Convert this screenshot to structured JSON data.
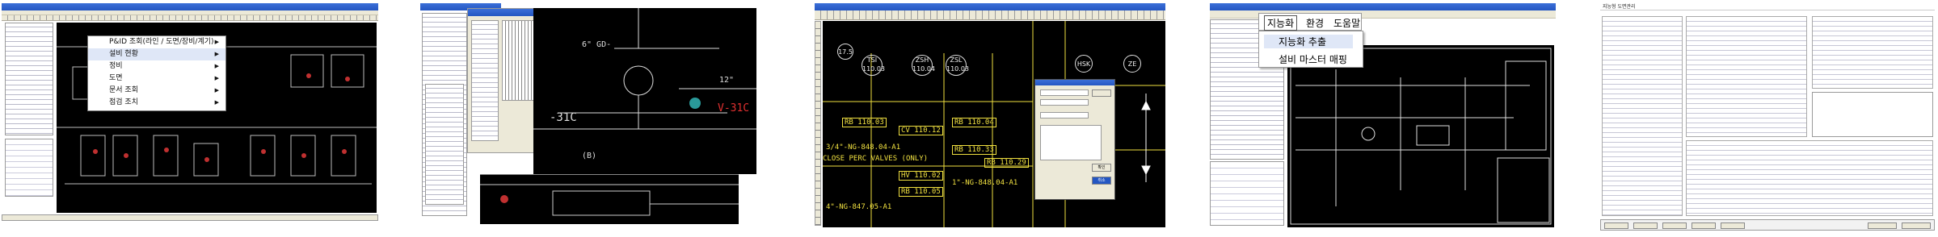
{
  "screen1": {
    "context_menu": {
      "items": [
        {
          "label": "P&ID 조회(라인 / 도면/장비/계기)",
          "arrow": "▶"
        },
        {
          "label": "설비 현황",
          "arrow": "▶"
        },
        {
          "label": "정비",
          "arrow": "▶"
        },
        {
          "label": "도면",
          "arrow": "▶"
        },
        {
          "label": "문서 조회",
          "arrow": "▶"
        },
        {
          "label": "점검 조치",
          "arrow": "▶"
        }
      ]
    }
  },
  "screen2": {
    "labels": [
      "6\" GD-",
      "-31C",
      "12\"",
      "(B)",
      "V-31C"
    ]
  },
  "screen3": {
    "bubbles": [
      "17.5",
      "TSI 110.03",
      "ZSH 110.04",
      "ZSL 110.03",
      "HSK",
      "ZE"
    ],
    "boxed_labels": [
      "RB 110.03",
      "CV 110.12",
      "RB 110.04",
      "RB 110.33",
      "RB 110.29",
      "HV 110.02",
      "RB 110.05"
    ],
    "lines": [
      "3/4\"-NG-848.04-A1",
      "CLOSE PERC VALVES (ONLY)",
      "1\"-NG-848.04-A1",
      "4\"-NG-847.05-A1"
    ],
    "dialog": {
      "btn_ok": "확인",
      "btn_cancel": "취소"
    }
  },
  "screen4": {
    "ribbon_tabs": [
      "지능화",
      "환경",
      "도움말"
    ],
    "menu_items": [
      "지능화 추출",
      "설비 마스터 매핑"
    ]
  },
  "screen5": {
    "window_title": "지능형 도면관리"
  },
  "colors": {
    "cad_bg": "#000000",
    "cad_yellow": "#f0e040",
    "xp_blue": "#2456c2"
  }
}
